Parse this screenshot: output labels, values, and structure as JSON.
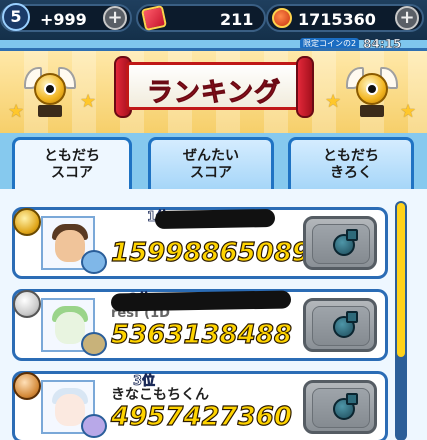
{
  "status_bar": {
    "level": "5",
    "coins": "+999",
    "tickets": "211",
    "points": "1715360",
    "limited_label": "限定コインの2",
    "limited_timer": "84:15"
  },
  "header": {
    "title": "ランキング"
  },
  "tabs": [
    {
      "label_line1": "ともだち",
      "label_line2": "スコア",
      "active": true
    },
    {
      "label_line1": "ぜんたい",
      "label_line2": "スコア",
      "active": false
    },
    {
      "label_line1": "ともだち",
      "label_line2": "きろく",
      "active": false
    }
  ],
  "rows": [
    {
      "rank": "1位",
      "medal": "gold",
      "name": "",
      "score": "15998865089",
      "hair_color": "#5a3a22",
      "mini_color": "#7fb7e8"
    },
    {
      "rank": "2位",
      "medal": "silver",
      "name": "resf (1D",
      "score": "5363138488",
      "hair_color": "#9ad48a",
      "mini_color": "#c8b27a"
    },
    {
      "rank": "3位",
      "medal": "bronze",
      "name": "きなこもちくん",
      "score": "4957427360",
      "hair_color": "#d8e6f4",
      "mini_color": "#b8a8e8"
    }
  ],
  "icons": [
    "ticket-icon",
    "coin-icon",
    "trophy-icon",
    "star-icon",
    "medal-icon",
    "bomb-icon",
    "plus-icon"
  ]
}
